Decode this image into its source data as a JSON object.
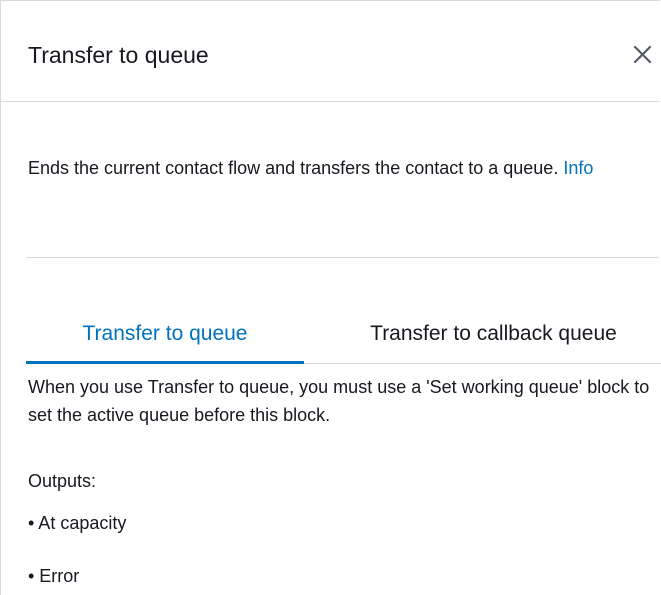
{
  "panel": {
    "title": "Transfer to queue",
    "close_icon": "close-icon"
  },
  "description": {
    "text": "Ends the current contact flow and transfers the contact to a queue. ",
    "info_link": "Info"
  },
  "tabs": [
    {
      "label": "Transfer to queue",
      "active": true
    },
    {
      "label": "Transfer to callback queue",
      "active": false
    }
  ],
  "tab_content": {
    "note": "When you use Transfer to queue, you must use a 'Set working queue' block to set the active queue before this block.",
    "outputs_label": "Outputs:",
    "outputs": [
      "• At capacity",
      "• Error"
    ]
  },
  "colors": {
    "accent": "#0073bb",
    "text": "#16191f",
    "divider": "#d5dbdb"
  }
}
